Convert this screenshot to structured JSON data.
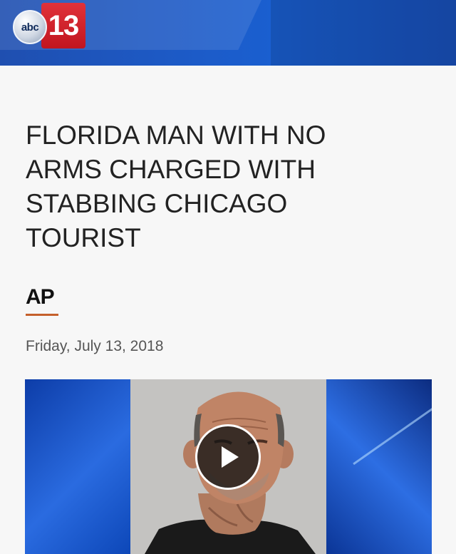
{
  "header": {
    "logo": {
      "abc_text": "abc",
      "number_text": "13"
    },
    "colors": {
      "bar": "#1d59c4",
      "logo_red": "#c1151f"
    }
  },
  "article": {
    "headline_lines": [
      "FLORIDA MAN WITH NO",
      "ARMS CHARGED WITH",
      "STABBING CHICAGO",
      "TOURIST"
    ],
    "source": "AP",
    "date": "Friday, July 13, 2018"
  },
  "video": {
    "play_icon": "play-icon",
    "accent": "#c5602c"
  }
}
